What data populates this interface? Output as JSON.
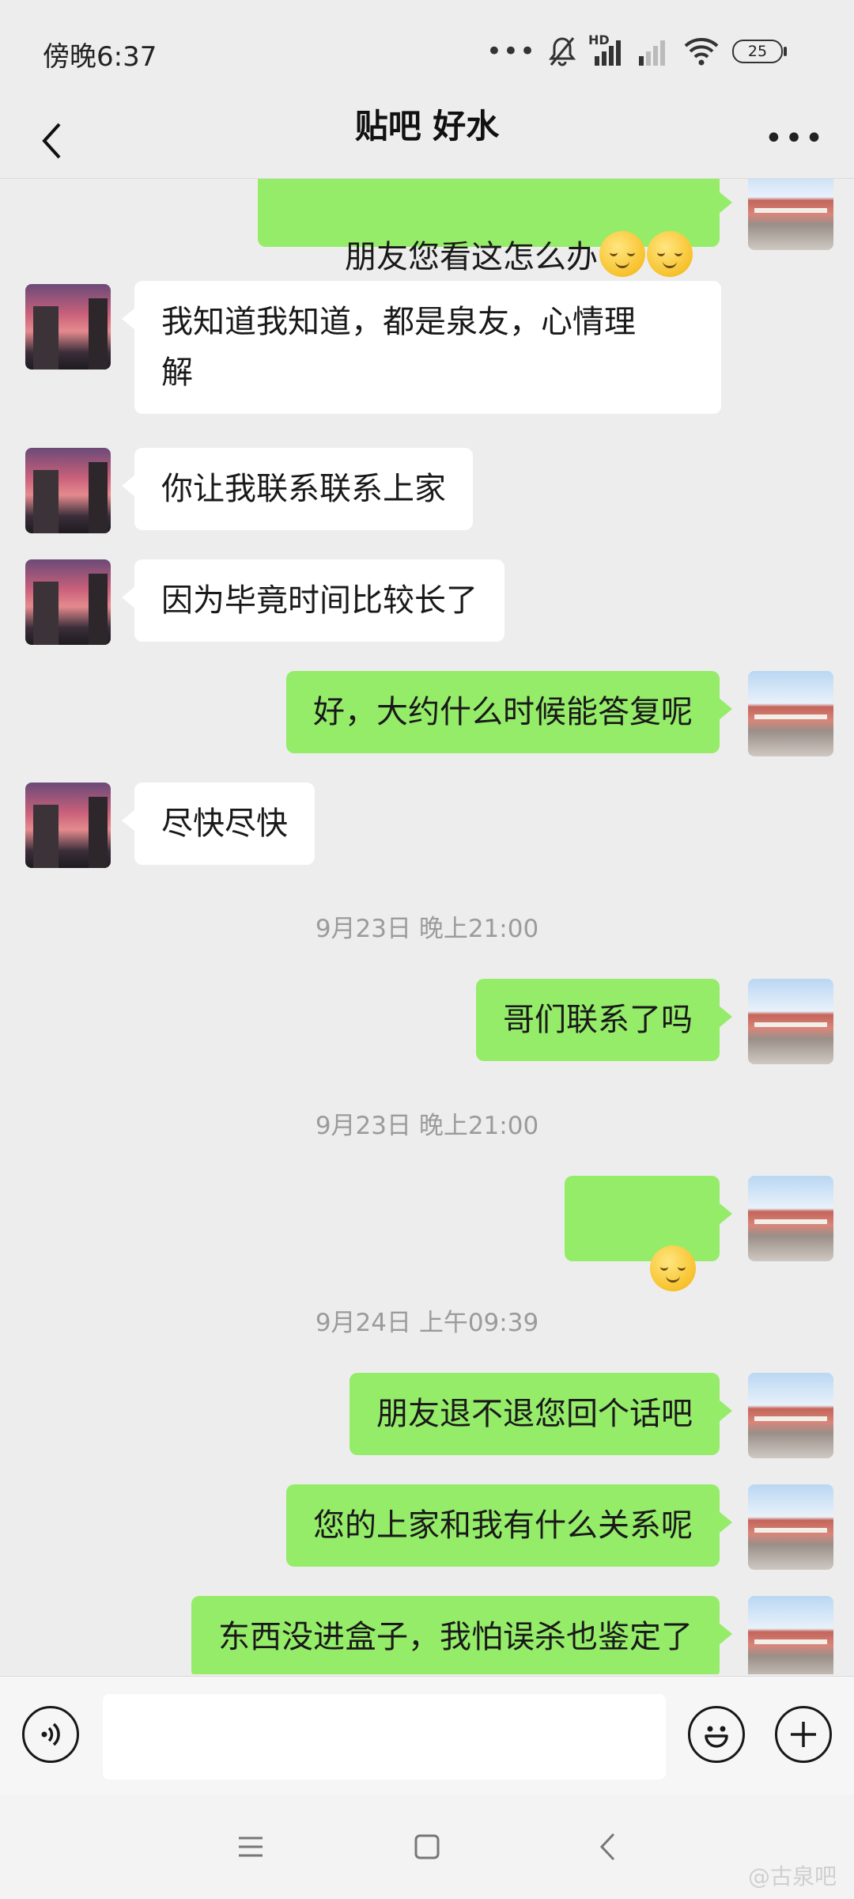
{
  "status_bar": {
    "time": "傍晚6:37",
    "network": "HD",
    "battery": "25"
  },
  "header": {
    "title": "贴吧 好水"
  },
  "messages": [
    {
      "side": "out",
      "text": "朋友您看这怎么办",
      "emoji_count": 2
    },
    {
      "side": "in",
      "text": "我知道我知道，都是泉友，心情理\n解"
    },
    {
      "side": "in",
      "text": "你让我联系联系上家"
    },
    {
      "side": "in",
      "text": "因为毕竟时间比较长了"
    },
    {
      "side": "out",
      "text": "好，大约什么时候能答复呢"
    },
    {
      "side": "in",
      "text": "尽快尽快"
    },
    {
      "type": "timestamp",
      "text": "9月23日 晚上21:00"
    },
    {
      "side": "out",
      "text": "哥们联系了吗"
    },
    {
      "type": "timestamp",
      "text": "9月23日 晚上21:00"
    },
    {
      "side": "out",
      "text": "",
      "emoji_count": 1
    },
    {
      "type": "timestamp",
      "text": "9月24日 上午09:39"
    },
    {
      "side": "out",
      "text": "朋友退不退您回个话吧"
    },
    {
      "side": "out",
      "text": "您的上家和我有什么关系呢"
    },
    {
      "side": "out",
      "text": "东西没进盒子，我怕误杀也鉴定了"
    }
  ],
  "input": {
    "value": "",
    "placeholder": ""
  },
  "watermark": "@古泉吧",
  "colors": {
    "outgoing": "#95ec69",
    "incoming": "#ffffff",
    "background": "#ededed"
  }
}
